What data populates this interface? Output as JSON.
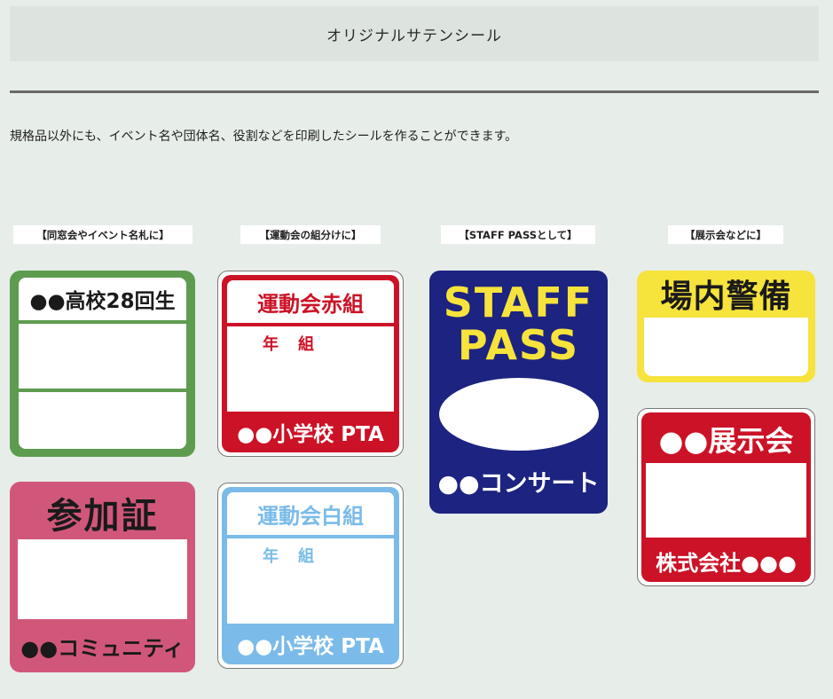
{
  "page": {
    "title": "オリジナルサテンシール",
    "description": "規格品以外にも、イベント名や団体名、役割などを印刷したシールを作ることができます。"
  },
  "captions": [
    "【同窓会やイベント名札に】",
    "【運動会の組分けに】",
    "【STAFF PASSとして】",
    "【展示会などに】"
  ],
  "stickers": {
    "alumni": {
      "header": "●●高校28回生",
      "color": "#5d9c4f"
    },
    "sanka": {
      "header": "参加証",
      "footer": "●●コミュニティ",
      "color": "#d1577a"
    },
    "red_team": {
      "header": "運動会赤組",
      "grade": "年　組",
      "footer": "●●小学校 PTA",
      "color": "#cc1226"
    },
    "white_team": {
      "header": "運動会白組",
      "grade": "年　組",
      "footer": "●●小学校 PTA",
      "color": "#7abbe9"
    },
    "staff": {
      "line1": "STAFF",
      "line2": "PASS",
      "footer": "●●コンサート",
      "color": "#1d2380",
      "accent": "#f6e33c"
    },
    "security": {
      "header": "場内警備",
      "color": "#f6e33c"
    },
    "exhibition": {
      "header": "●●展示会",
      "footer": "株式会社●●●",
      "color": "#cc1226"
    }
  }
}
